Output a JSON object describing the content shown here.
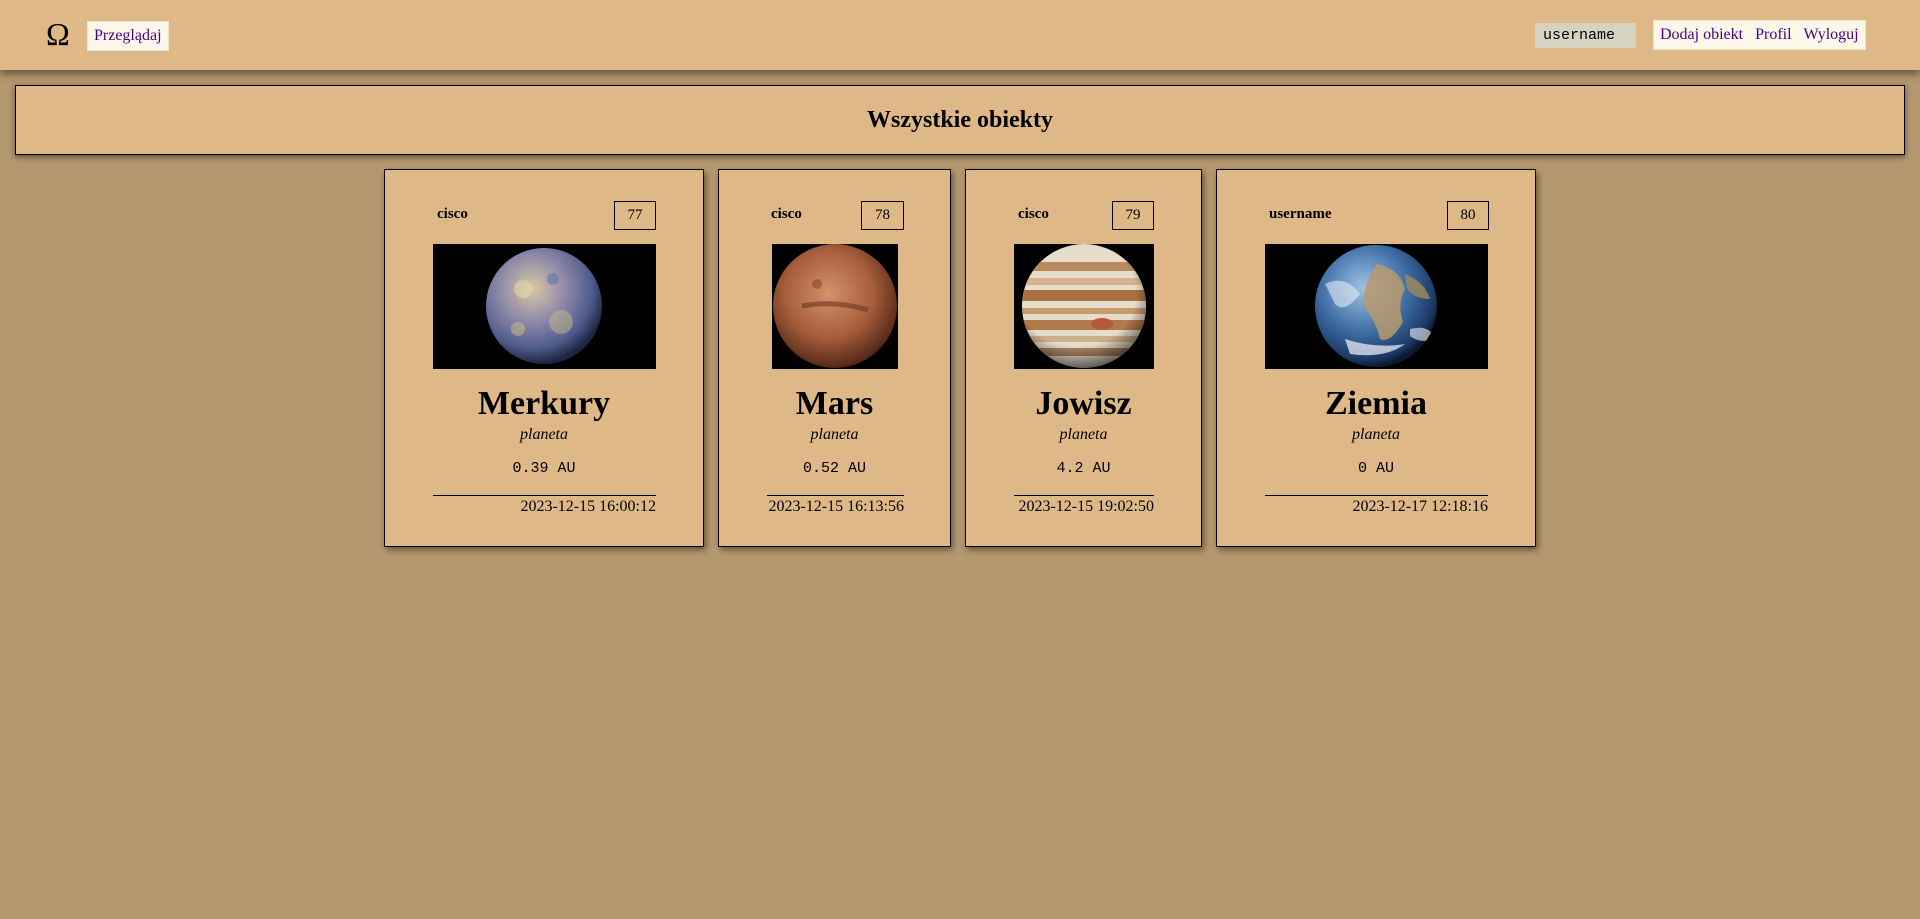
{
  "nav": {
    "logo_glyph": "Ω",
    "browse_label": "Przeglądaj",
    "username": "username",
    "add_label": "Dodaj obiekt",
    "profile_label": "Profil",
    "logout_label": "Wyloguj"
  },
  "page": {
    "title": "Wszystkie obiekty"
  },
  "objects": [
    {
      "author": "cisco",
      "id": "77",
      "name": "Merkury",
      "type": "planeta",
      "distance": "0.39 AU",
      "date": "2023-12-15 16:00:12",
      "image": "mercury-planet-image"
    },
    {
      "author": "cisco",
      "id": "78",
      "name": "Mars",
      "type": "planeta",
      "distance": "0.52 AU",
      "date": "2023-12-15 16:13:56",
      "image": "mars-planet-image"
    },
    {
      "author": "cisco",
      "id": "79",
      "name": "Jowisz",
      "type": "planeta",
      "distance": "4.2 AU",
      "date": "2023-12-15 19:02:50",
      "image": "jupiter-planet-image"
    },
    {
      "author": "username",
      "id": "80",
      "name": "Ziemia",
      "type": "planeta",
      "distance": "0 AU",
      "date": "2023-12-17 12:18:16",
      "image": "earth-planet-image"
    }
  ],
  "colors": {
    "background": "#b5986f",
    "panel": "#deb887",
    "link": "#4b0082",
    "link_bg": "#fbf8ea"
  }
}
